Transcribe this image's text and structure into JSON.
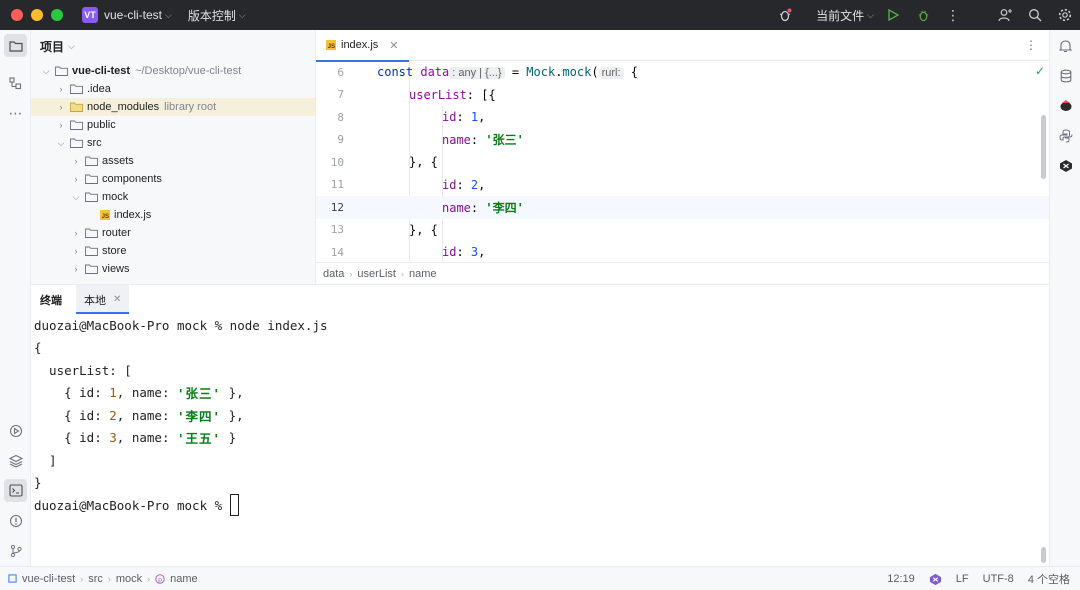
{
  "titlebar": {
    "project_badge": "VT",
    "project_name": "vue-cli-test",
    "vcs_label": "版本控制",
    "run_config": "当前文件"
  },
  "project_panel": {
    "title": "项目",
    "tree": [
      {
        "name": "vue-cli-test",
        "suffix": "~/Desktop/vue-cli-test",
        "kind": "root",
        "depth": 0,
        "expanded": true
      },
      {
        "name": ".idea",
        "suffix": "",
        "kind": "folder",
        "depth": 1,
        "expanded": false
      },
      {
        "name": "node_modules",
        "suffix": "library root",
        "kind": "folder-lib",
        "depth": 1,
        "expanded": false,
        "selected": true
      },
      {
        "name": "public",
        "suffix": "",
        "kind": "folder",
        "depth": 1,
        "expanded": false
      },
      {
        "name": "src",
        "suffix": "",
        "kind": "folder",
        "depth": 1,
        "expanded": true
      },
      {
        "name": "assets",
        "suffix": "",
        "kind": "folder",
        "depth": 2,
        "expanded": false
      },
      {
        "name": "components",
        "suffix": "",
        "kind": "folder",
        "depth": 2,
        "expanded": false
      },
      {
        "name": "mock",
        "suffix": "",
        "kind": "folder",
        "depth": 2,
        "expanded": true
      },
      {
        "name": "index.js",
        "suffix": "",
        "kind": "js",
        "depth": 3,
        "expanded": false
      },
      {
        "name": "router",
        "suffix": "",
        "kind": "folder",
        "depth": 2,
        "expanded": false
      },
      {
        "name": "store",
        "suffix": "",
        "kind": "folder",
        "depth": 2,
        "expanded": false
      },
      {
        "name": "views",
        "suffix": "",
        "kind": "folder",
        "depth": 2,
        "expanded": false
      }
    ]
  },
  "editor": {
    "tab_label": "index.js",
    "tab_icon": "JS",
    "lines": [
      {
        "num": "6"
      },
      {
        "num": "7"
      },
      {
        "num": "8"
      },
      {
        "num": "9"
      },
      {
        "num": "10"
      },
      {
        "num": "11"
      },
      {
        "num": "12"
      },
      {
        "num": "13"
      },
      {
        "num": "14"
      }
    ],
    "code": {
      "l6_const": "const",
      "l6_var": "data",
      "l6_hint_type": ": any | {...}",
      "l6_eq": " = ",
      "l6_obj": "Mock",
      "l6_dot": ".",
      "l6_fn": "mock",
      "l6_paren": "(",
      "l6_hint_param": "rurl:",
      "l6_brace": " {",
      "l7_prop": "userList",
      "l7_rest": ": [{",
      "id_prop": "id",
      "name_prop": "name",
      "colon": ": ",
      "comma": ",",
      "l8_val": "1",
      "l9_val": "'张三'",
      "l10": "}, {",
      "l11_val": "2",
      "l12_val": "'李四'",
      "l13": "}, {",
      "l14_val": "3"
    },
    "breadcrumb": [
      "data",
      "userList",
      "name"
    ]
  },
  "terminal": {
    "title": "终端",
    "tab_label": "本地",
    "prompt": "duozai@MacBook-Pro mock % ",
    "command": "node index.js",
    "output": {
      "open": "{",
      "list_open": "  userList: [",
      "item_prefix": "    { id: ",
      "item_mid": ", name: ",
      "item_end": " },",
      "item_end_last": " }",
      "items": [
        {
          "id": "1",
          "name": "'张三'"
        },
        {
          "id": "2",
          "name": "'李四'"
        },
        {
          "id": "3",
          "name": "'王五'"
        }
      ],
      "list_close": "  ]",
      "close": "}"
    },
    "prompt2": "duozai@MacBook-Pro mock % "
  },
  "statusbar": {
    "path": [
      "vue-cli-test",
      "src",
      "mock",
      "name"
    ],
    "position": "12:19",
    "line_sep": "LF",
    "encoding": "UTF-8",
    "indent": "4 个空格"
  },
  "colors": {
    "accent": "#3574f0",
    "keyword": "#0033b3",
    "string": "#067d17",
    "number": "#1750eb",
    "property": "#871094"
  }
}
